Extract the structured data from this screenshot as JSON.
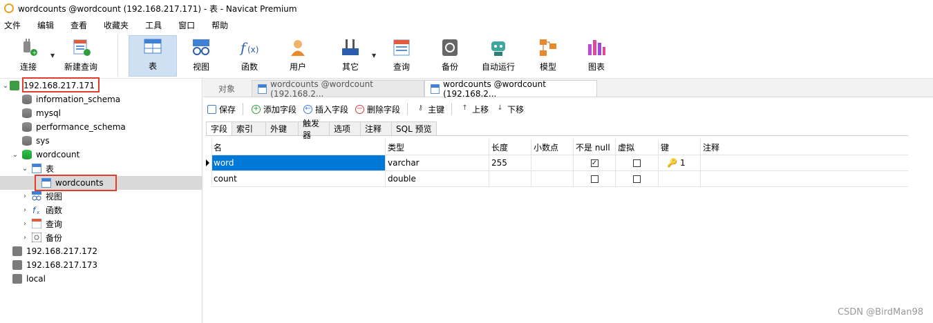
{
  "window": {
    "title": "wordcounts @wordcount (192.168.217.171) - 表 - Navicat Premium"
  },
  "menu": [
    "文件",
    "编辑",
    "查看",
    "收藏夹",
    "工具",
    "窗口",
    "帮助"
  ],
  "toolbar": [
    {
      "label": "连接",
      "icon": "connection-plug-icon"
    },
    {
      "label": "新建查询",
      "icon": "new-query-icon"
    },
    {
      "label": "表",
      "icon": "table-icon",
      "active": true
    },
    {
      "label": "视图",
      "icon": "view-glasses-icon"
    },
    {
      "label": "函数",
      "icon": "function-fx-icon"
    },
    {
      "label": "用户",
      "icon": "user-icon"
    },
    {
      "label": "其它",
      "icon": "tools-icon"
    },
    {
      "label": "查询",
      "icon": "query-icon"
    },
    {
      "label": "备份",
      "icon": "backup-icon"
    },
    {
      "label": "自动运行",
      "icon": "robot-icon"
    },
    {
      "label": "模型",
      "icon": "model-icon"
    },
    {
      "label": "图表",
      "icon": "chart-icon"
    }
  ],
  "tree": {
    "connection": "192.168.217.171",
    "databases": [
      "information_schema",
      "mysql",
      "performance_schema",
      "sys"
    ],
    "open_db": "wordcount",
    "tables_node": "表",
    "table": "wordcounts",
    "other_nodes": [
      "视图",
      "函数",
      "查询",
      "备份"
    ],
    "other_connections": [
      "192.168.217.172",
      "192.168.217.173",
      "local"
    ]
  },
  "tabs": {
    "objects": "对象",
    "doc1": "wordcounts @wordcount (192.168.2...",
    "doc2": "wordcounts @wordcount (192.168.2..."
  },
  "edit_toolbar": {
    "save": "保存",
    "add_field": "添加字段",
    "insert_field": "插入字段",
    "delete_field": "删除字段",
    "primary_key": "主键",
    "move_up": "上移",
    "move_down": "下移"
  },
  "subtabs": [
    "字段",
    "索引",
    "外键",
    "触发器",
    "选项",
    "注释",
    "SQL 预览"
  ],
  "columns": [
    "名",
    "类型",
    "长度",
    "小数点",
    "不是 null",
    "虚拟",
    "键",
    "注释"
  ],
  "rows": [
    {
      "name": "word",
      "type": "varchar",
      "length": "255",
      "decimals": "",
      "not_null": true,
      "virtual": false,
      "key": "1",
      "comment": ""
    },
    {
      "name": "count",
      "type": "double",
      "length": "",
      "decimals": "",
      "not_null": false,
      "virtual": false,
      "key": "",
      "comment": ""
    }
  ],
  "watermark": "CSDN @BirdMan98"
}
